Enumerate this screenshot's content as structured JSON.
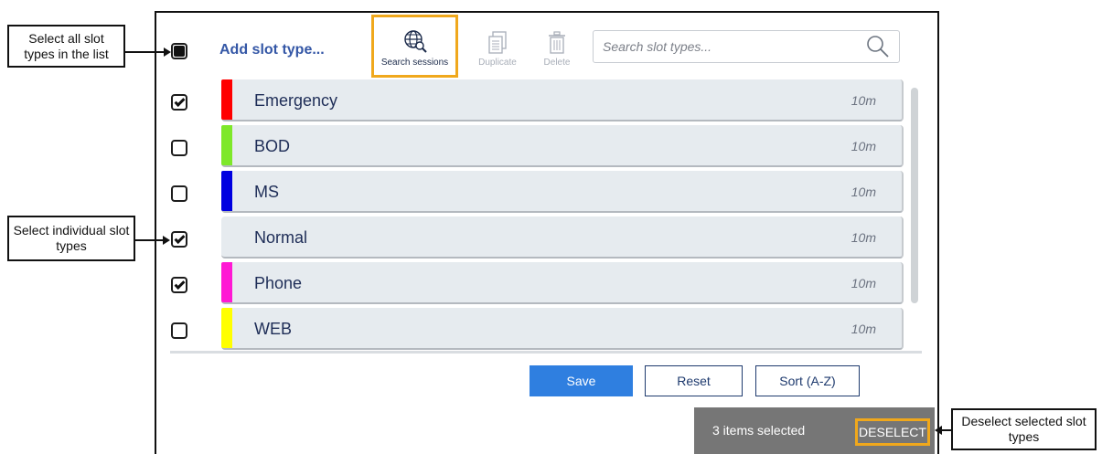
{
  "callouts": {
    "select_all": "Select all slot types in the list",
    "select_individual": "Select individual slot types",
    "deselect": "Deselect selected slot types"
  },
  "toolbar": {
    "add_slot_type": "Add slot type...",
    "search_sessions": "Search sessions",
    "duplicate": "Duplicate",
    "delete": "Delete",
    "search_placeholder": "Search slot types..."
  },
  "slot_types": [
    {
      "name": "Emergency",
      "duration": "10m",
      "color": "#ff0000",
      "checked": true
    },
    {
      "name": "BOD",
      "duration": "10m",
      "color": "#7ee82a",
      "checked": false
    },
    {
      "name": "MS",
      "duration": "10m",
      "color": "#0000e0",
      "checked": false
    },
    {
      "name": "Normal",
      "duration": "10m",
      "color": "",
      "checked": true
    },
    {
      "name": "Phone",
      "duration": "10m",
      "color": "#ff19d4",
      "checked": true
    },
    {
      "name": "WEB",
      "duration": "10m",
      "color": "#ffff00",
      "checked": false
    }
  ],
  "buttons": {
    "save": "Save",
    "reset": "Reset",
    "sort": "Sort (A-Z)"
  },
  "selection_bar": {
    "count_text": "3 items selected",
    "deselect": "DESELECT"
  },
  "colors": {
    "accent": "#2f7fe0",
    "highlight": "#f0a81c",
    "title": "#3457a6"
  }
}
